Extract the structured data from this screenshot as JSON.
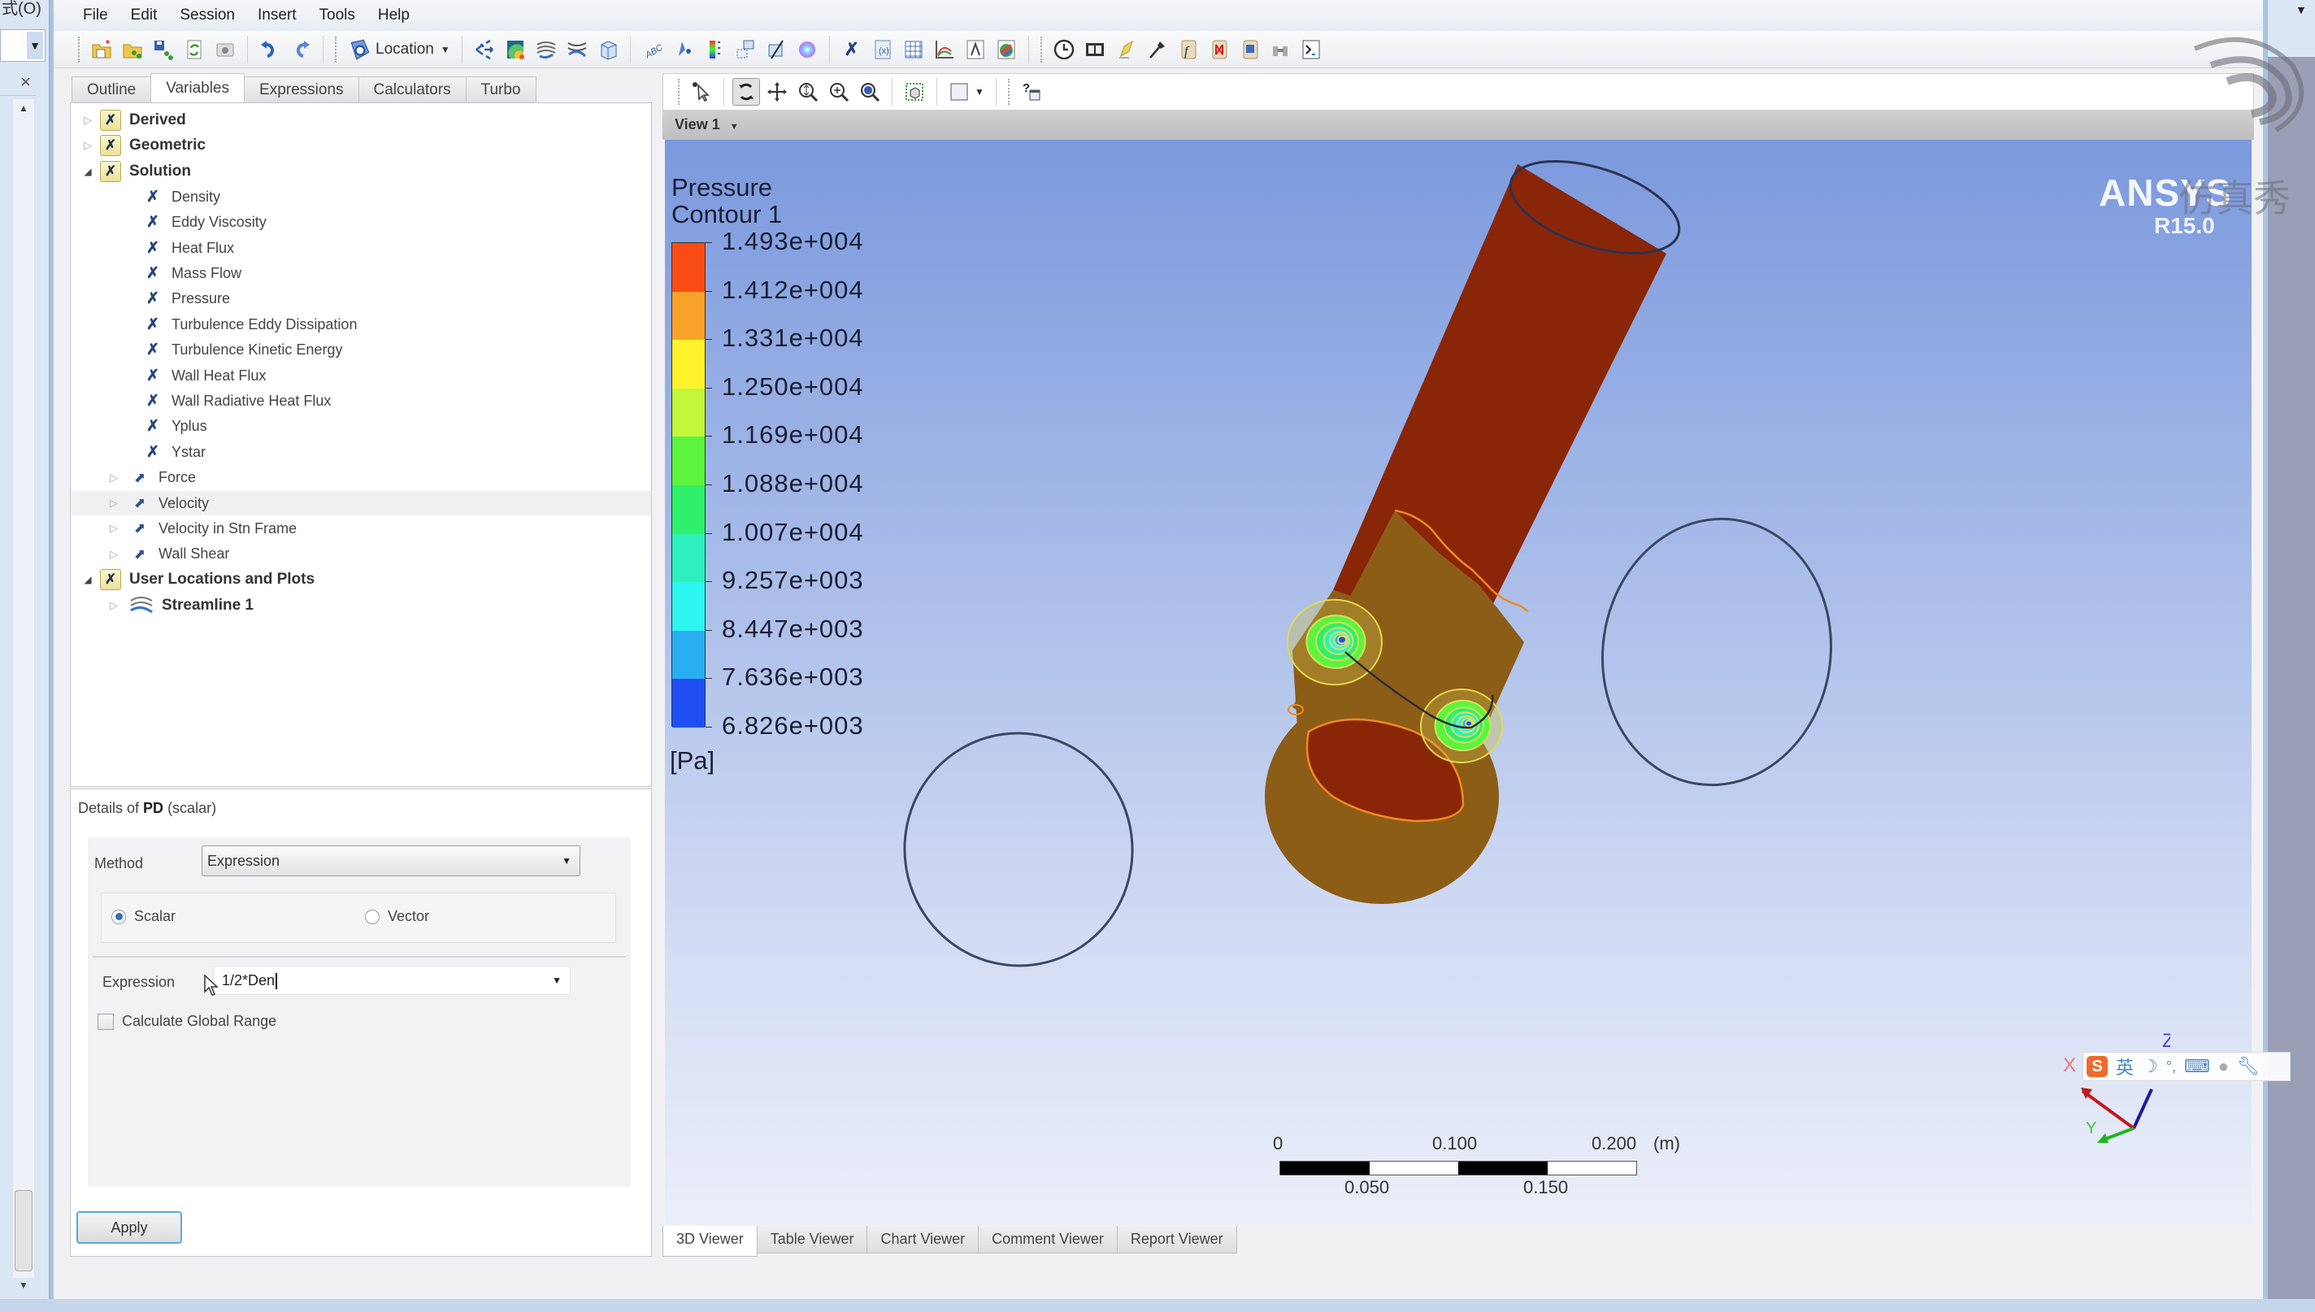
{
  "host": {
    "menu_fragment": "式(O)",
    "close_glyph": "×"
  },
  "menu": {
    "items": [
      "File",
      "Edit",
      "Session",
      "Insert",
      "Tools",
      "Help"
    ]
  },
  "toolbar": {
    "location_label": "Location",
    "icons": [
      "new-folder-icon",
      "open-icon",
      "save-icon",
      "refresh-icon",
      "screenshot-icon",
      "undo-icon",
      "redo-icon",
      "location-icon",
      "vector-icon",
      "contour-icon",
      "streamline-icon",
      "particle-track-icon",
      "volume-icon",
      "text-icon",
      "point-icon",
      "legend-icon",
      "instance-transform-icon",
      "clip-plane-icon",
      "color-map-icon",
      "variable-icon",
      "expression-icon",
      "table-icon",
      "chart-icon",
      "comment-icon",
      "figure-icon",
      "timestep-icon",
      "animation-icon",
      "quick-editor-icon",
      "probe-icon",
      "function-calculator-icon",
      "macro-calculator-icon",
      "mesh-calculator-icon",
      "case-comparison-icon",
      "command-editor-icon"
    ]
  },
  "left_panel": {
    "tabs": [
      "Outline",
      "Variables",
      "Expressions",
      "Calculators",
      "Turbo"
    ],
    "active_tab": "Variables",
    "tree": [
      {
        "label": "Derived",
        "level": 0,
        "type": "folder",
        "state": "collapsed",
        "bold": true
      },
      {
        "label": "Geometric",
        "level": 0,
        "type": "folder",
        "state": "collapsed",
        "bold": true
      },
      {
        "label": "Solution",
        "level": 0,
        "type": "folder",
        "state": "expanded",
        "bold": true
      },
      {
        "label": "Density",
        "level": 1,
        "type": "scalar"
      },
      {
        "label": "Eddy Viscosity",
        "level": 1,
        "type": "scalar"
      },
      {
        "label": "Heat Flux",
        "level": 1,
        "type": "scalar"
      },
      {
        "label": "Mass Flow",
        "level": 1,
        "type": "scalar"
      },
      {
        "label": "Pressure",
        "level": 1,
        "type": "scalar"
      },
      {
        "label": "Turbulence Eddy Dissipation",
        "level": 1,
        "type": "scalar"
      },
      {
        "label": "Turbulence Kinetic Energy",
        "level": 1,
        "type": "scalar"
      },
      {
        "label": "Wall Heat Flux",
        "level": 1,
        "type": "scalar"
      },
      {
        "label": "Wall Radiative Heat Flux",
        "level": 1,
        "type": "scalar"
      },
      {
        "label": "Yplus",
        "level": 1,
        "type": "scalar"
      },
      {
        "label": "Ystar",
        "level": 1,
        "type": "scalar"
      },
      {
        "label": "Force",
        "level": 1,
        "type": "vector",
        "state": "collapsed"
      },
      {
        "label": "Velocity",
        "level": 1,
        "type": "vector",
        "state": "collapsed",
        "highlighted": true
      },
      {
        "label": "Velocity in Stn Frame",
        "level": 1,
        "type": "vector",
        "state": "collapsed"
      },
      {
        "label": "Wall Shear",
        "level": 1,
        "type": "vector",
        "state": "collapsed"
      },
      {
        "label": "User Locations and Plots",
        "level": 0,
        "type": "folder",
        "state": "expanded",
        "bold": true
      },
      {
        "label": "Streamline 1",
        "level": 1,
        "type": "streamline",
        "state": "collapsed",
        "bold": true
      }
    ]
  },
  "details": {
    "title_prefix": "Details of ",
    "title_name": "PD",
    "title_suffix": " (scalar)",
    "method_label": "Method",
    "method_value": "Expression",
    "radio_scalar": "Scalar",
    "radio_vector": "Vector",
    "selected_radio": "Scalar",
    "expression_label": "Expression",
    "expression_value": "1/2*Den",
    "global_range_label": "Calculate Global Range",
    "global_range_checked": false,
    "apply_label": "Apply"
  },
  "viewer": {
    "view_name": "View 1",
    "tabs": [
      "3D Viewer",
      "Table Viewer",
      "Chart Viewer",
      "Comment Viewer",
      "Report Viewer"
    ],
    "active_tab": "3D Viewer",
    "toolbar_icons": [
      "select-icon",
      "rotate-icon",
      "pan-icon",
      "zoom-icon",
      "zoom-box-icon",
      "fit-view-icon",
      "toggle-mesh-icon",
      "viewport-layout-icon",
      "help-icon"
    ]
  },
  "legend": {
    "title_line1": "Pressure",
    "title_line2": "Contour 1",
    "unit": "[Pa]",
    "labels": [
      "1.493e+004",
      "1.412e+004",
      "1.331e+004",
      "1.250e+004",
      "1.169e+004",
      "1.088e+004",
      "1.007e+004",
      "9.257e+003",
      "8.447e+003",
      "7.636e+003",
      "6.826e+003"
    ],
    "colors": [
      "#fb4b14",
      "#f9a22a",
      "#fdf22b",
      "#c2f73a",
      "#5cf43d",
      "#2ef06a",
      "#2ef0bc",
      "#2df6f0",
      "#2aaef2",
      "#1f4ff2"
    ]
  },
  "branding": {
    "product": "ANSYS",
    "version": "R15.0",
    "watermark": "仿真秀"
  },
  "scale_bar": {
    "top_labels": [
      "0",
      "0.100",
      "0.200"
    ],
    "bottom_labels": [
      "0.050",
      "0.150"
    ],
    "unit": "(m)"
  },
  "axes": {
    "x": "X",
    "y": "Y",
    "z": "Z"
  },
  "ime": {
    "logo": "S",
    "mode": "英",
    "items": [
      "moon-icon",
      "punctuation-icon",
      "keyboard-icon",
      "user-icon",
      "wrench-icon"
    ]
  },
  "contour_colors": {
    "high": "#8a2608",
    "mid": "#8c5d17",
    "outline_orange": "#f08a20",
    "outline_yellow": "#e5d84a"
  }
}
